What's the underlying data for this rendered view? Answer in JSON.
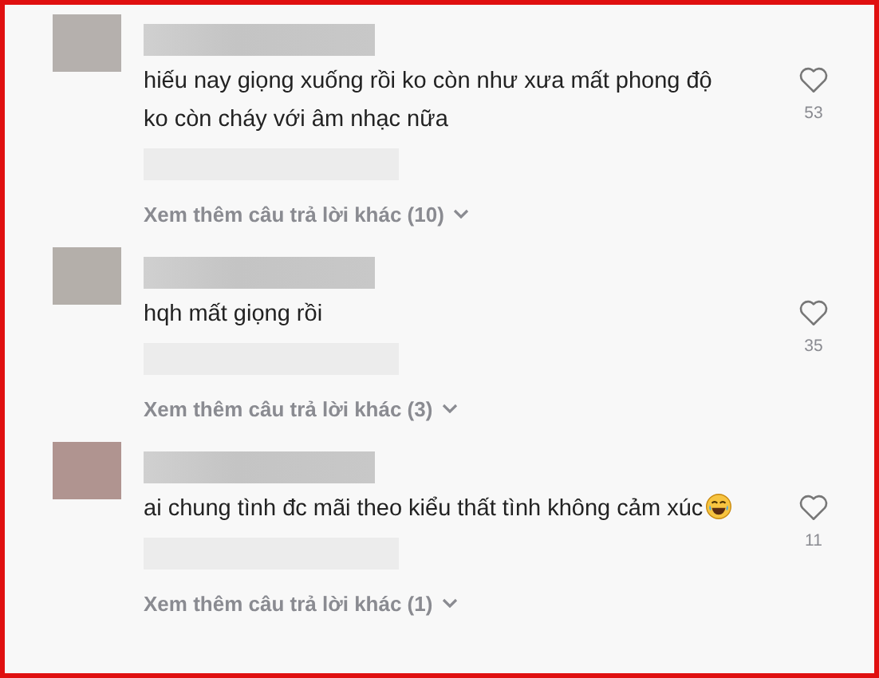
{
  "comments": [
    {
      "color": "#b5b0ad",
      "text": "hiếu nay giọng xuống rồi ko còn như xưa mất phong độ ko còn cháy với âm nhạc nữa",
      "emoji": false,
      "likes": "53",
      "more_replies": "Xem thêm câu trả lời khác (10)"
    },
    {
      "color": "#b4afaa",
      "text": "hqh mất giọng rồi",
      "emoji": false,
      "likes": "35",
      "more_replies": "Xem thêm câu trả lời khác (3)"
    },
    {
      "color": "#b09490",
      "text": "ai chung tình đc mãi theo kiểu thất tình không cảm xúc",
      "emoji": true,
      "likes": "11",
      "more_replies": "Xem thêm câu trả lời khác (1)"
    }
  ]
}
